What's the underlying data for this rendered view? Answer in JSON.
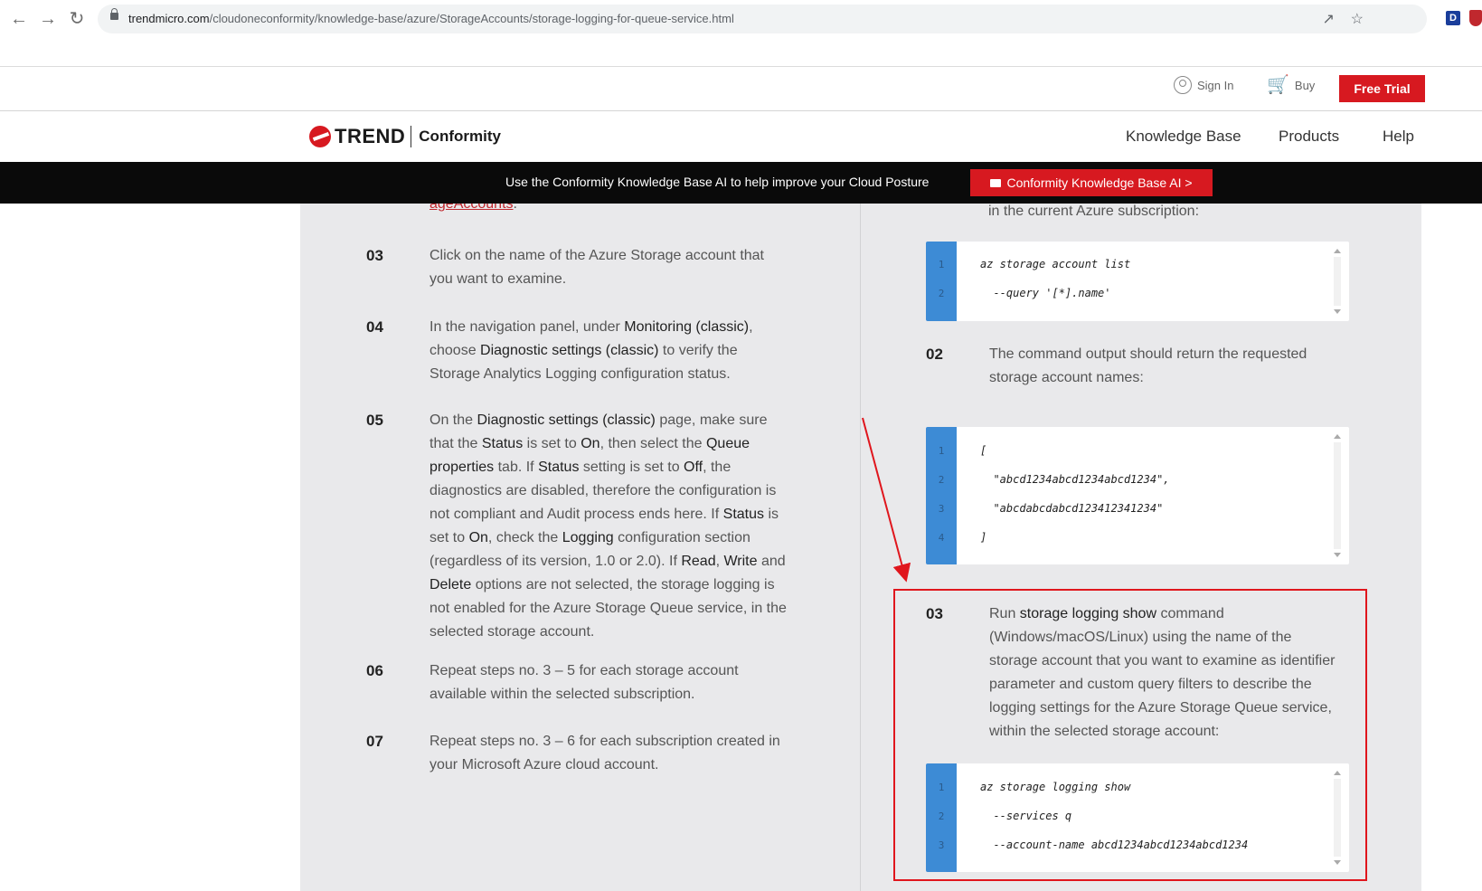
{
  "browser": {
    "url_host": "trendmicro.com",
    "url_path": "/cloudoneconformity/knowledge-base/azure/StorageAccounts/storage-logging-for-queue-service.html",
    "ext_d": "D"
  },
  "utility": {
    "signin": "Sign In",
    "buy": "Buy",
    "free_trial": "Free Trial"
  },
  "header": {
    "logo_trend": "TREND",
    "logo_product": "Conformity",
    "nav": [
      "Knowledge Base",
      "Products",
      "Help"
    ]
  },
  "banner": {
    "text": "Use the Conformity Knowledge Base AI to help improve your Cloud Posture",
    "button": "Conformity Knowledge Base AI >"
  },
  "left_steps": {
    "partial_link": "ageAccounts",
    "partial_suffix": ".",
    "s03": {
      "num": "03",
      "text": "Click on the name of the Azure Storage account that you want to examine."
    },
    "s04": {
      "num": "04",
      "p1": "In the navigation panel, under ",
      "b1": "Monitoring (classic)",
      "p2": ", choose ",
      "b2": "Diagnostic settings (classic)",
      "p3": " to verify the Storage Analytics Logging configuration status."
    },
    "s05": {
      "num": "05",
      "p1": "On the ",
      "b1": "Diagnostic settings (classic)",
      "p2": " page, make sure that the ",
      "b2": "Status",
      "p3": " is set to ",
      "b3": "On",
      "p4": ", then select the ",
      "b4": "Queue properties",
      "p5": " tab. If ",
      "b5": "Status",
      "p6": " setting is set to ",
      "b6": "Off",
      "p7": ", the diagnostics are disabled, therefore the configuration is not compliant and Audit process ends here. If ",
      "b7": "Status",
      "p8": " is set to ",
      "b8": "On",
      "p9": ", check the ",
      "b9": "Logging",
      "p10": " configuration section (regardless of its version, 1.0 or 2.0). If ",
      "b10": "Read",
      "p11": ", ",
      "b11": "Write",
      "p12": " and ",
      "b12": "Delete",
      "p13": " options are not selected, the storage logging is not enabled for the Azure Storage Queue service, in the selected storage account."
    },
    "s06": {
      "num": "06",
      "text": "Repeat steps no. 3 – 5 for each storage account available within the selected subscription."
    },
    "s07": {
      "num": "07",
      "text": "Repeat steps no. 3 – 6 for each subscription created in your Microsoft Azure cloud account."
    }
  },
  "right_steps": {
    "partial_text": "in the current Azure subscription:",
    "code1": {
      "lines": [
        "1",
        "2"
      ],
      "code": [
        "az storage account list",
        "  --query '[*].name'"
      ]
    },
    "s02": {
      "num": "02",
      "text": "The command output should return the requested storage account names:"
    },
    "code2": {
      "lines": [
        "1",
        "2",
        "3",
        "4"
      ],
      "code": [
        "[",
        "  \"abcd1234abcd1234abcd1234\",",
        "  \"abcdabcdabcd123412341234\"",
        "]"
      ]
    },
    "s03": {
      "num": "03",
      "p1": "Run ",
      "b1": "storage logging show",
      "p2": " command (Windows/macOS/Linux) using the name of the storage account that you want to examine as identifier parameter and custom query filters to describe the logging settings for the Azure Storage Queue service, within the selected storage account:"
    },
    "code3": {
      "lines": [
        "1",
        "2",
        "3"
      ],
      "code": [
        "az storage logging show",
        "  --services q",
        "  --account-name abcd1234abcd1234abcd1234"
      ]
    }
  },
  "colors": {
    "accent": "#d71920",
    "code_gutter": "#3d8bd5",
    "annotation": "#e0161d"
  }
}
